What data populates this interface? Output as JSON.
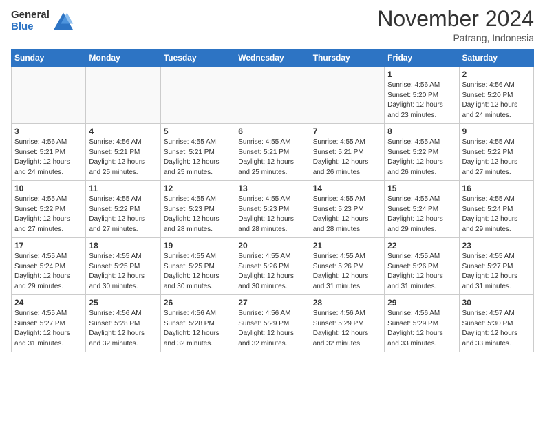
{
  "header": {
    "logo_general": "General",
    "logo_blue": "Blue",
    "month": "November 2024",
    "location": "Patrang, Indonesia"
  },
  "weekdays": [
    "Sunday",
    "Monday",
    "Tuesday",
    "Wednesday",
    "Thursday",
    "Friday",
    "Saturday"
  ],
  "weeks": [
    [
      {
        "day": "",
        "info": ""
      },
      {
        "day": "",
        "info": ""
      },
      {
        "day": "",
        "info": ""
      },
      {
        "day": "",
        "info": ""
      },
      {
        "day": "",
        "info": ""
      },
      {
        "day": "1",
        "info": "Sunrise: 4:56 AM\nSunset: 5:20 PM\nDaylight: 12 hours\nand 23 minutes."
      },
      {
        "day": "2",
        "info": "Sunrise: 4:56 AM\nSunset: 5:20 PM\nDaylight: 12 hours\nand 24 minutes."
      }
    ],
    [
      {
        "day": "3",
        "info": "Sunrise: 4:56 AM\nSunset: 5:21 PM\nDaylight: 12 hours\nand 24 minutes."
      },
      {
        "day": "4",
        "info": "Sunrise: 4:56 AM\nSunset: 5:21 PM\nDaylight: 12 hours\nand 25 minutes."
      },
      {
        "day": "5",
        "info": "Sunrise: 4:55 AM\nSunset: 5:21 PM\nDaylight: 12 hours\nand 25 minutes."
      },
      {
        "day": "6",
        "info": "Sunrise: 4:55 AM\nSunset: 5:21 PM\nDaylight: 12 hours\nand 25 minutes."
      },
      {
        "day": "7",
        "info": "Sunrise: 4:55 AM\nSunset: 5:21 PM\nDaylight: 12 hours\nand 26 minutes."
      },
      {
        "day": "8",
        "info": "Sunrise: 4:55 AM\nSunset: 5:22 PM\nDaylight: 12 hours\nand 26 minutes."
      },
      {
        "day": "9",
        "info": "Sunrise: 4:55 AM\nSunset: 5:22 PM\nDaylight: 12 hours\nand 27 minutes."
      }
    ],
    [
      {
        "day": "10",
        "info": "Sunrise: 4:55 AM\nSunset: 5:22 PM\nDaylight: 12 hours\nand 27 minutes."
      },
      {
        "day": "11",
        "info": "Sunrise: 4:55 AM\nSunset: 5:22 PM\nDaylight: 12 hours\nand 27 minutes."
      },
      {
        "day": "12",
        "info": "Sunrise: 4:55 AM\nSunset: 5:23 PM\nDaylight: 12 hours\nand 28 minutes."
      },
      {
        "day": "13",
        "info": "Sunrise: 4:55 AM\nSunset: 5:23 PM\nDaylight: 12 hours\nand 28 minutes."
      },
      {
        "day": "14",
        "info": "Sunrise: 4:55 AM\nSunset: 5:23 PM\nDaylight: 12 hours\nand 28 minutes."
      },
      {
        "day": "15",
        "info": "Sunrise: 4:55 AM\nSunset: 5:24 PM\nDaylight: 12 hours\nand 29 minutes."
      },
      {
        "day": "16",
        "info": "Sunrise: 4:55 AM\nSunset: 5:24 PM\nDaylight: 12 hours\nand 29 minutes."
      }
    ],
    [
      {
        "day": "17",
        "info": "Sunrise: 4:55 AM\nSunset: 5:24 PM\nDaylight: 12 hours\nand 29 minutes."
      },
      {
        "day": "18",
        "info": "Sunrise: 4:55 AM\nSunset: 5:25 PM\nDaylight: 12 hours\nand 30 minutes."
      },
      {
        "day": "19",
        "info": "Sunrise: 4:55 AM\nSunset: 5:25 PM\nDaylight: 12 hours\nand 30 minutes."
      },
      {
        "day": "20",
        "info": "Sunrise: 4:55 AM\nSunset: 5:26 PM\nDaylight: 12 hours\nand 30 minutes."
      },
      {
        "day": "21",
        "info": "Sunrise: 4:55 AM\nSunset: 5:26 PM\nDaylight: 12 hours\nand 31 minutes."
      },
      {
        "day": "22",
        "info": "Sunrise: 4:55 AM\nSunset: 5:26 PM\nDaylight: 12 hours\nand 31 minutes."
      },
      {
        "day": "23",
        "info": "Sunrise: 4:55 AM\nSunset: 5:27 PM\nDaylight: 12 hours\nand 31 minutes."
      }
    ],
    [
      {
        "day": "24",
        "info": "Sunrise: 4:55 AM\nSunset: 5:27 PM\nDaylight: 12 hours\nand 31 minutes."
      },
      {
        "day": "25",
        "info": "Sunrise: 4:56 AM\nSunset: 5:28 PM\nDaylight: 12 hours\nand 32 minutes."
      },
      {
        "day": "26",
        "info": "Sunrise: 4:56 AM\nSunset: 5:28 PM\nDaylight: 12 hours\nand 32 minutes."
      },
      {
        "day": "27",
        "info": "Sunrise: 4:56 AM\nSunset: 5:29 PM\nDaylight: 12 hours\nand 32 minutes."
      },
      {
        "day": "28",
        "info": "Sunrise: 4:56 AM\nSunset: 5:29 PM\nDaylight: 12 hours\nand 32 minutes."
      },
      {
        "day": "29",
        "info": "Sunrise: 4:56 AM\nSunset: 5:29 PM\nDaylight: 12 hours\nand 33 minutes."
      },
      {
        "day": "30",
        "info": "Sunrise: 4:57 AM\nSunset: 5:30 PM\nDaylight: 12 hours\nand 33 minutes."
      }
    ]
  ]
}
